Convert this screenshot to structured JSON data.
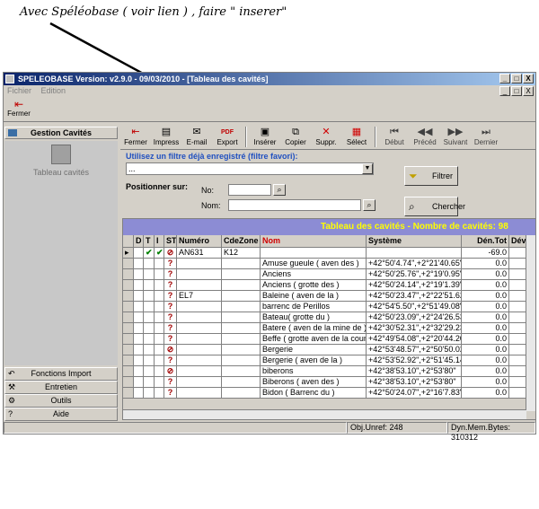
{
  "annotation": "Avec Spéléobase ( voir lien ) , faire \" inserer\"",
  "window": {
    "title": "SPELEOBASE  Version: v2.9.0 - 09/03/2010 - [Tableau des cavités]",
    "min": "_",
    "restore": "□",
    "close": "X"
  },
  "menu": {
    "fichier": "Fichier",
    "edition": "Edition"
  },
  "mainbar": {
    "fermer": "Fermer"
  },
  "left": {
    "gestion": "Gestion Cavités",
    "tableau": "Tableau cavités",
    "buttons": [
      "Fonctions Import",
      "Entretien",
      "Outils",
      "Aide"
    ]
  },
  "toolbar": {
    "items": [
      "Fermer",
      "Impress",
      "E-mail",
      "Export",
      "Insérer",
      "Copier",
      "Suppr.",
      "Sélect",
      "Début",
      "Précéd",
      "Suivant",
      "Dernier"
    ],
    "pdf_badge": "PDF"
  },
  "filter": {
    "label": "Utilisez un filtre déjà enregistré (filtre favori):",
    "value": "...",
    "positionner": "Positionner sur:",
    "no_label": "No:",
    "nom_label": "Nom:",
    "filtrer": "Filtrer",
    "chercher": "Chercher"
  },
  "grid": {
    "title": "Tableau des cavités - Nombre de cavités: 98",
    "headers": [
      "",
      "D",
      "T",
      "I",
      "ST",
      "Numéro",
      "CdeZone",
      "Nom",
      "Système",
      "Dén.Tot",
      "Dév."
    ],
    "rows": [
      {
        "ptr": "▸",
        "d": "",
        "t": "✔",
        "i": "✔",
        "st": "⊘",
        "num": "AN631",
        "zone": "K12",
        "nom": "",
        "sys": "",
        "den": "-69.0"
      },
      {
        "ptr": "",
        "d": "",
        "t": "",
        "i": "",
        "st": "?",
        "num": "",
        "zone": "",
        "nom": "Amuse gueule ( aven des )",
        "sys": "+42°50'4.74\",+2°21'40.65\"",
        "den": "0.0"
      },
      {
        "ptr": "",
        "d": "",
        "t": "",
        "i": "",
        "st": "?",
        "num": "",
        "zone": "",
        "nom": "Anciens",
        "sys": "+42°50'25.76\",+2°19'0.95\"",
        "den": "0.0"
      },
      {
        "ptr": "",
        "d": "",
        "t": "",
        "i": "",
        "st": "?",
        "num": "",
        "zone": "",
        "nom": "Anciens ( grotte des )",
        "sys": "+42°50'24.14\",+2°19'1.39\"",
        "den": "0.0"
      },
      {
        "ptr": "",
        "d": "",
        "t": "",
        "i": "",
        "st": "?",
        "num": "EL7",
        "zone": "",
        "nom": "Baleine ( aven de la )",
        "sys": "+42°50'23.47\",+2°22'51.62\"",
        "den": "0.0"
      },
      {
        "ptr": "",
        "d": "",
        "t": "",
        "i": "",
        "st": "?",
        "num": "",
        "zone": "",
        "nom": "barrenc de Perillos",
        "sys": "+42°54'5.50\",+2°51'49.08\"",
        "den": "0.0"
      },
      {
        "ptr": "",
        "d": "",
        "t": "",
        "i": "",
        "st": "?",
        "num": "",
        "zone": "",
        "nom": "Bateau( grotte du )",
        "sys": "+42°50'23.09\",+2°24'26.53\"",
        "den": "0.0"
      },
      {
        "ptr": "",
        "d": "",
        "t": "",
        "i": "",
        "st": "?",
        "num": "",
        "zone": "",
        "nom": "Batere ( aven de la mine de )",
        "sys": "+42°30'52.31\",+2°32'29.23\"",
        "den": "0.0"
      },
      {
        "ptr": "",
        "d": "",
        "t": "",
        "i": "",
        "st": "?",
        "num": "",
        "zone": "",
        "nom": "Beffe ( grotte aven de la coume d'i",
        "sys": "+42°49'54.08\",+2°20'44.20\"",
        "den": "0.0"
      },
      {
        "ptr": "",
        "d": "",
        "t": "",
        "i": "",
        "st": "⊘",
        "num": "",
        "zone": "",
        "nom": "Bergerie",
        "sys": "+42°53'48.57\",+2°50'50.02\"",
        "den": "0.0"
      },
      {
        "ptr": "",
        "d": "",
        "t": "",
        "i": "",
        "st": "?",
        "num": "",
        "zone": "",
        "nom": "Bergerie ( aven de la )",
        "sys": "+42°53'52.92\",+2°51'45.14\"",
        "den": "0.0"
      },
      {
        "ptr": "",
        "d": "",
        "t": "",
        "i": "",
        "st": "⊘",
        "num": "",
        "zone": "",
        "nom": "biberons",
        "sys": "+42°38'53.10\",+2°53'80\"",
        "den": "0.0"
      },
      {
        "ptr": "",
        "d": "",
        "t": "",
        "i": "",
        "st": "?",
        "num": "",
        "zone": "",
        "nom": "Biberons ( aven des )",
        "sys": "+42°38'53.10\",+2°53'80\"",
        "den": "0.0"
      },
      {
        "ptr": "",
        "d": "",
        "t": "",
        "i": "",
        "st": "?",
        "num": "",
        "zone": "",
        "nom": "Bidon ( Barrenc du )",
        "sys": "+42°50'24.07\",+2°16'7.83\"",
        "den": "0.0"
      }
    ]
  },
  "status": {
    "left": "",
    "unref": "Obj.Unref: 248",
    "mem": "Dyn.Mem.Bytes: 310312"
  }
}
